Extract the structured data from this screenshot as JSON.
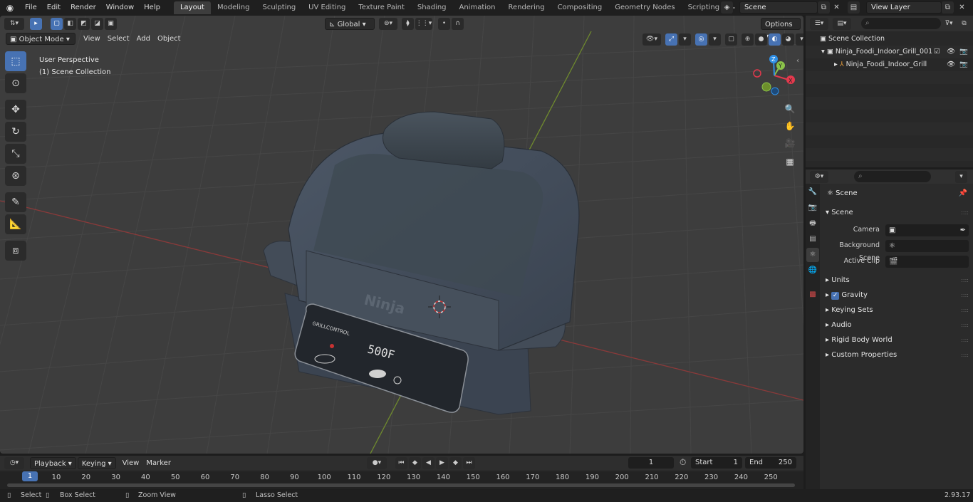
{
  "topbar": {
    "menus": [
      "File",
      "Edit",
      "Render",
      "Window",
      "Help"
    ],
    "workspaces": [
      "Layout",
      "Modeling",
      "Sculpting",
      "UV Editing",
      "Texture Paint",
      "Shading",
      "Animation",
      "Rendering",
      "Compositing",
      "Geometry Nodes",
      "Scripting"
    ],
    "active_workspace": "Layout",
    "scene": "Scene",
    "view_layer": "View Layer"
  },
  "viewport": {
    "mode": "Object Mode",
    "menus": [
      "View",
      "Select",
      "Add",
      "Object"
    ],
    "transform_orientation": "Global",
    "options_label": "Options",
    "perspective_label": "User Perspective",
    "collection_label": "(1) Scene Collection",
    "model_brand": "Ninja",
    "panel_brand": "GRILLCONTROL",
    "display_temp": "500F",
    "gizmo": {
      "x_label": "X",
      "y_label": "Y",
      "z_label": "Z",
      "x_color": "#e3394d",
      "y_color": "#8bc34a",
      "z_color": "#2f8fe5"
    }
  },
  "outliner": {
    "search_placeholder": "",
    "rows": [
      {
        "label": "Scene Collection"
      },
      {
        "label": "Ninja_Foodi_Indoor_Grill_001"
      },
      {
        "label": "Ninja_Foodi_Indoor_Grill"
      }
    ]
  },
  "properties": {
    "title": "Scene",
    "section": "Scene",
    "fields": [
      {
        "label": "Camera",
        "value": ""
      },
      {
        "label": "Background Scene",
        "value": ""
      },
      {
        "label": "Active Clip",
        "value": ""
      }
    ],
    "panels": [
      "Units",
      "Gravity",
      "Keying Sets",
      "Audio",
      "Rigid Body World",
      "Custom Properties"
    ]
  },
  "timeline": {
    "menus": [
      "Playback",
      "Keying",
      "View",
      "Marker"
    ],
    "current_frame": "1",
    "start_label": "Start",
    "start_value": "1",
    "end_label": "End",
    "end_value": "250",
    "ticks": [
      "10",
      "20",
      "30",
      "40",
      "50",
      "60",
      "70",
      "80",
      "90",
      "100",
      "110",
      "120",
      "130",
      "140",
      "150",
      "160",
      "170",
      "180",
      "190",
      "200",
      "210",
      "220",
      "230",
      "240",
      "250"
    ],
    "cursor_frame": "1"
  },
  "statusbar": {
    "select": "Select",
    "box_select": "Box Select",
    "zoom_view": "Zoom View",
    "lasso_select": "Lasso Select",
    "version": "2.93.17"
  },
  "colors": {
    "accent": "#4772b3",
    "x_axis": "#c0403f",
    "y_axis": "#8fb532"
  }
}
